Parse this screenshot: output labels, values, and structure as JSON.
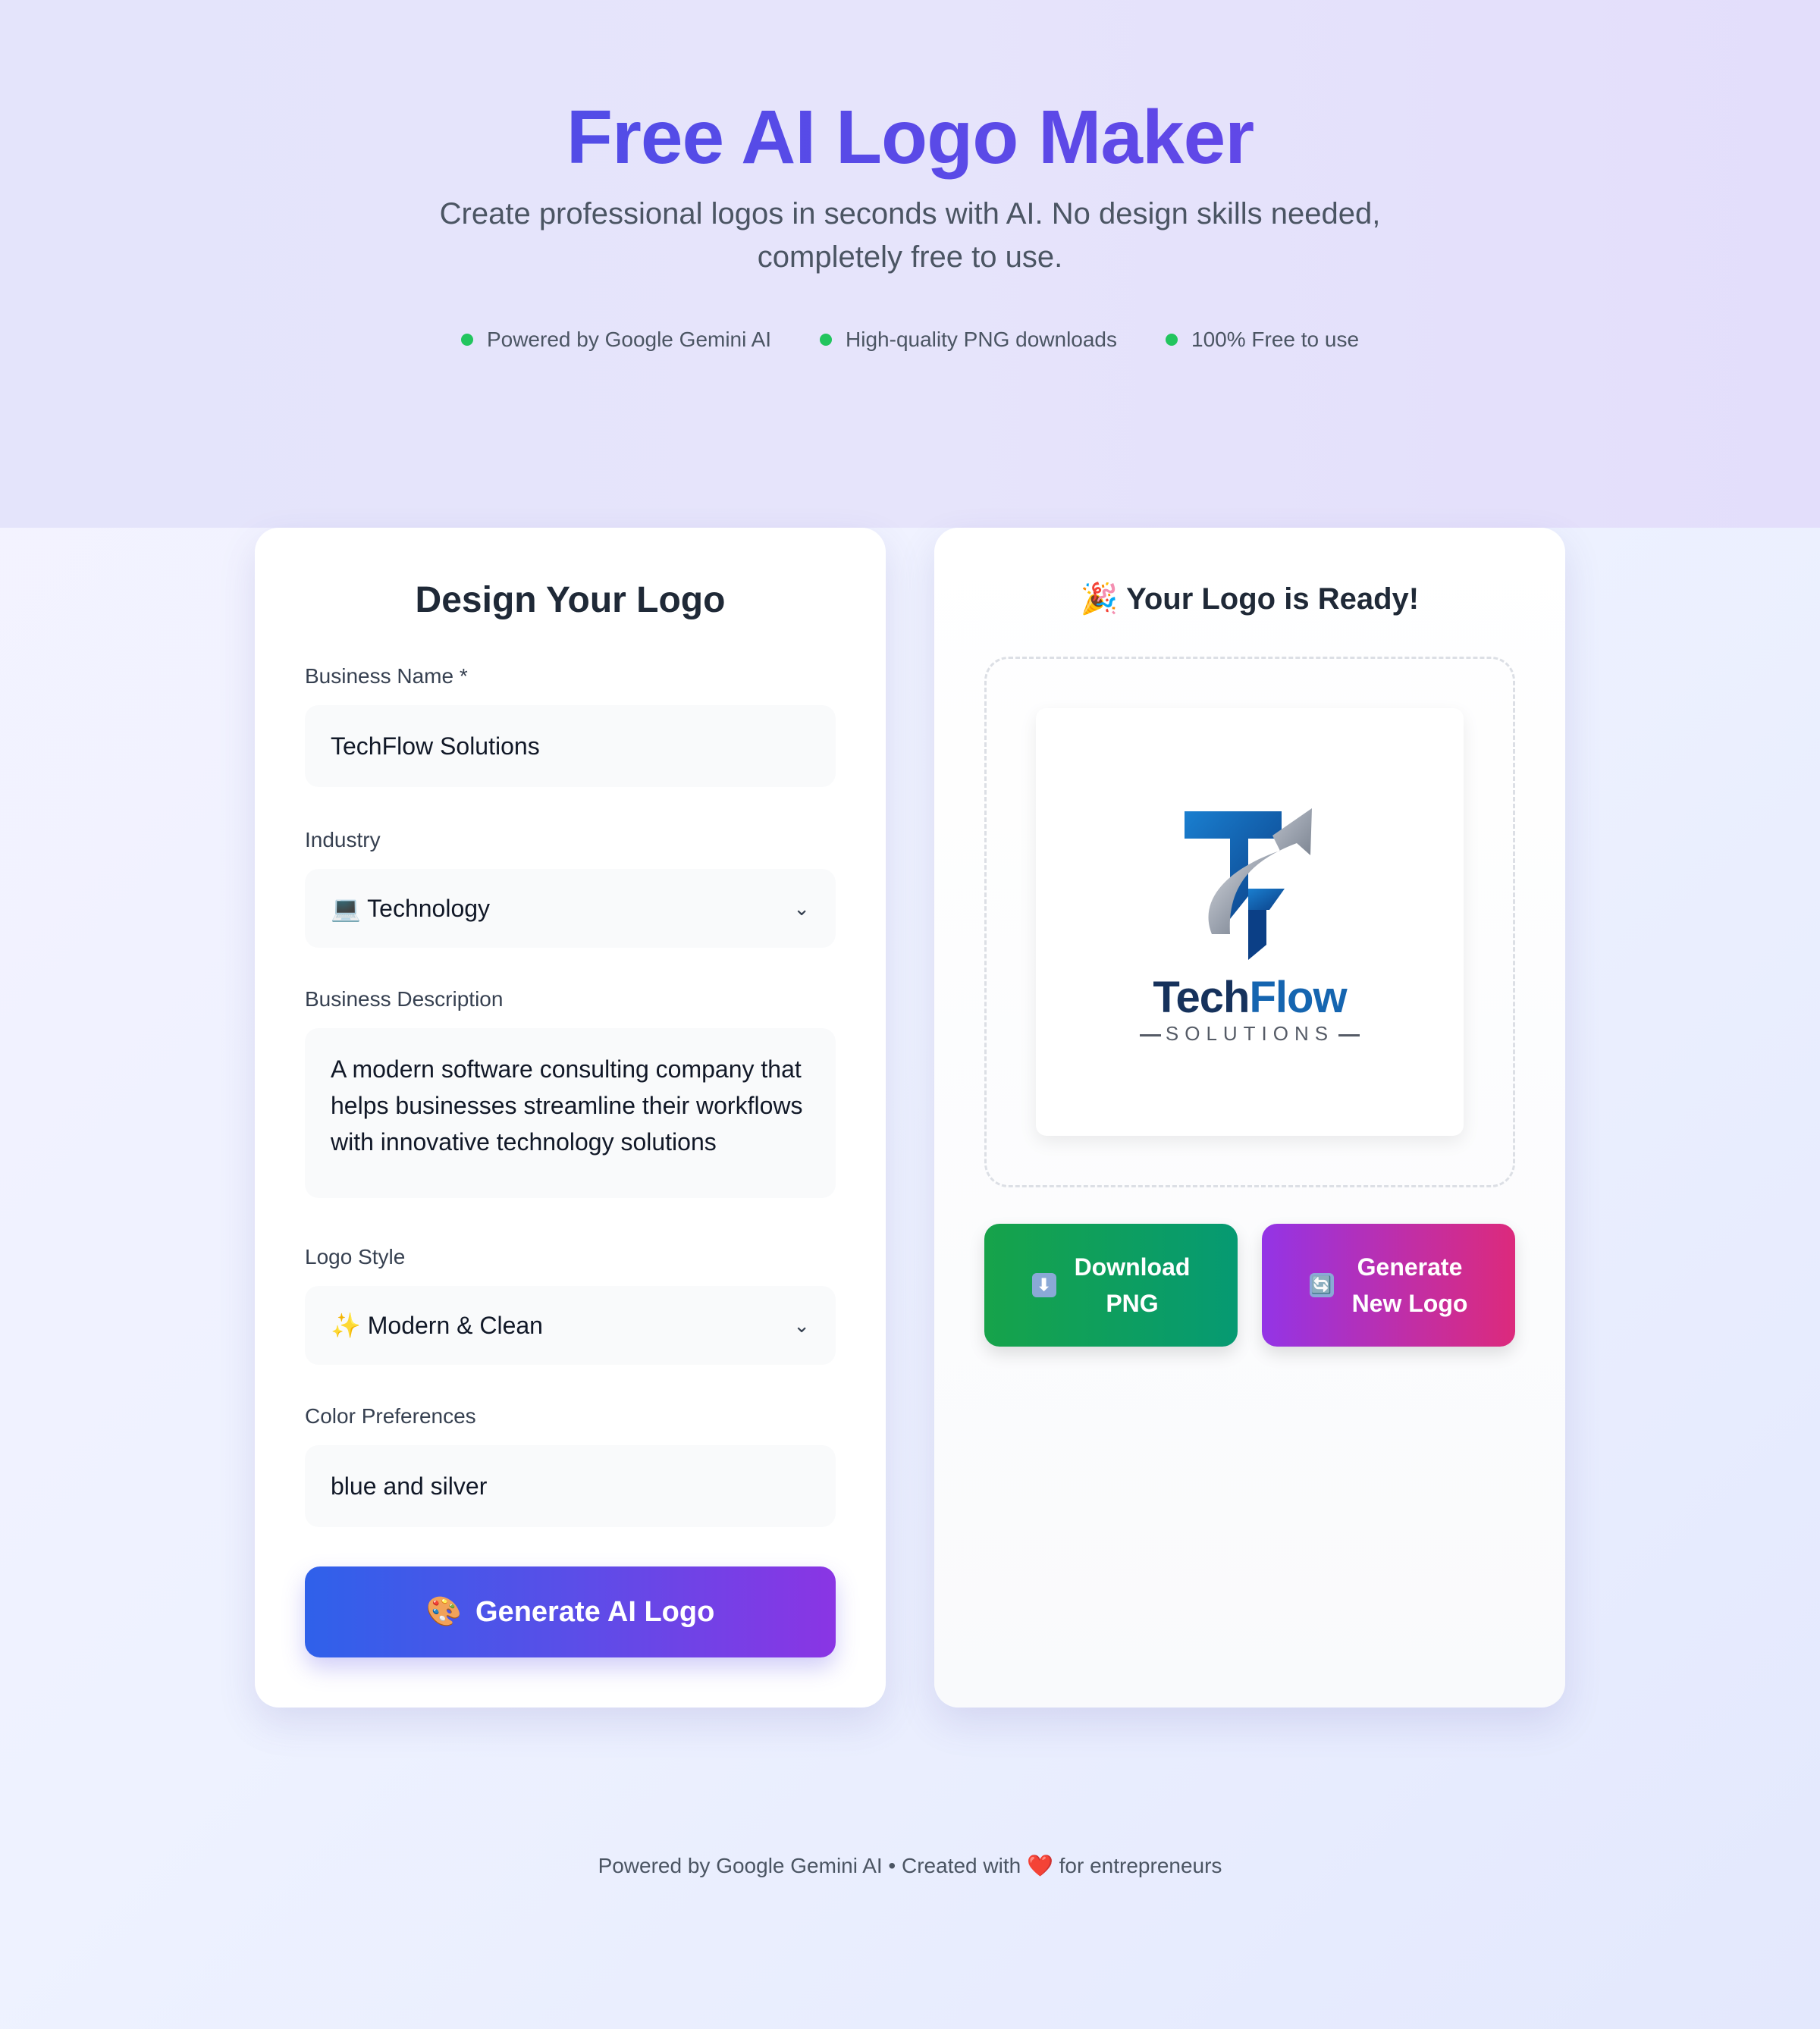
{
  "hero": {
    "title": "Free AI Logo Maker",
    "subtitle": "Create professional logos in seconds with AI. No design skills needed, completely free to use.",
    "features": [
      "Powered by Google Gemini AI",
      "High-quality PNG downloads",
      "100% Free to use"
    ]
  },
  "form": {
    "title": "Design Your Logo",
    "business_name_label": "Business Name *",
    "business_name_value": "TechFlow Solutions",
    "industry_label": "Industry",
    "industry_icon": "💻",
    "industry_value": "Technology",
    "description_label": "Business Description",
    "description_value": "A modern software consulting company that helps businesses streamline their workflows with innovative technology solutions",
    "style_label": "Logo Style",
    "style_icon": "✨",
    "style_value": "Modern & Clean",
    "color_label": "Color Preferences",
    "color_value": "blue and silver",
    "generate_icon": "🎨",
    "generate_label": "Generate AI Logo"
  },
  "result": {
    "title_icon": "🎉",
    "title": "Your Logo is Ready!",
    "logo_text_tech": "Tech",
    "logo_text_flow": "Flow",
    "logo_subtext": "SOLUTIONS",
    "download_icon": "⬇",
    "download_line1": "Download",
    "download_line2": "PNG",
    "regen_icon": "🔄",
    "regen_line1": "Generate",
    "regen_line2": "New Logo"
  },
  "footer": {
    "text_before": "Powered by Google Gemini AI • Created with",
    "heart": "❤️",
    "text_after": "for entrepreneurs"
  },
  "colors": {
    "accent_blue": "#4650e6",
    "accent_purple": "#6d44e8",
    "feature_dot": "#22c55e",
    "download_green": "#16a34a",
    "regen_pink": "#dc2a7c"
  }
}
